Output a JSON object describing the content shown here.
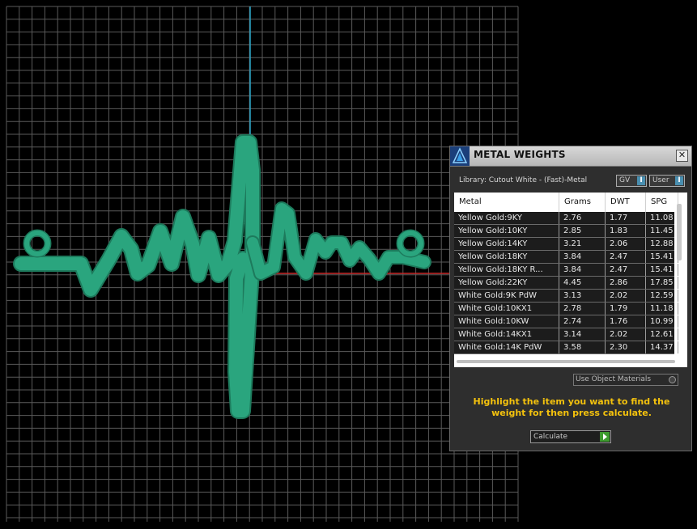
{
  "viewport": {
    "grid_color": "#6e6e6e",
    "axis_y_color": "#2aa7c9",
    "axis_x_color": "#c92a2a",
    "shape_color": "#2aa57e",
    "shape_outline": "#1d7a5c"
  },
  "panel": {
    "title": "METAL WEIGHTS",
    "close_label": "✕",
    "library_label": "Library: Cutout White - (Fast)-Metal",
    "toggle_gv": "GV",
    "toggle_user": "User",
    "toggle_indicator": "I",
    "columns": [
      "Metal",
      "Grams",
      "DWT",
      "SPG"
    ],
    "rows": [
      [
        "Yellow Gold:9KY",
        "2.76",
        "1.77",
        "11.08"
      ],
      [
        "Yellow Gold:10KY",
        "2.85",
        "1.83",
        "11.45"
      ],
      [
        "Yellow Gold:14KY",
        "3.21",
        "2.06",
        "12.88"
      ],
      [
        "Yellow Gold:18KY",
        "3.84",
        "2.47",
        "15.41"
      ],
      [
        "Yellow Gold:18KY R...",
        "3.84",
        "2.47",
        "15.41"
      ],
      [
        "Yellow Gold:22KY",
        "4.45",
        "2.86",
        "17.85"
      ],
      [
        "White Gold:9K PdW",
        "3.13",
        "2.02",
        "12.59"
      ],
      [
        "White Gold:10KX1",
        "2.78",
        "1.79",
        "11.18"
      ],
      [
        "White Gold:10KW",
        "2.74",
        "1.76",
        "10.99"
      ],
      [
        "White Gold:14KX1",
        "3.14",
        "2.02",
        "12.61"
      ],
      [
        "White Gold:14K PdW",
        "3.58",
        "2.30",
        "14.37"
      ]
    ],
    "use_object_materials": "Use Object Materials",
    "instruction": "Highlight the item you want to find the weight for then press calculate.",
    "calculate_label": "Calculate",
    "accent_color": "#f4c20d"
  }
}
